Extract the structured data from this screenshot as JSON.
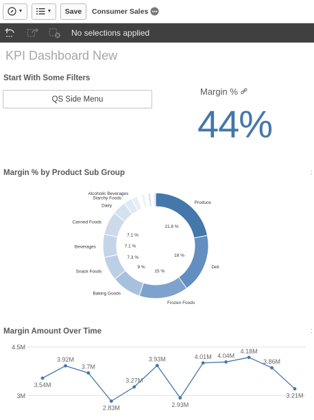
{
  "toolbar": {
    "compass_icon": "compass-icon",
    "list_icon": "list-icon",
    "save_label": "Save",
    "app_name": "Consumer Sales"
  },
  "selections": {
    "status": "No selections applied"
  },
  "sheet": {
    "title": "KPI Dashboard New"
  },
  "filters": {
    "title": "Start With Some Filters",
    "menu_button": "QS Side Menu"
  },
  "kpi": {
    "label": "Margin %",
    "value": "44%"
  },
  "colors": {
    "accent": "#4477aa",
    "selbar": "#404040"
  },
  "donut": {
    "title": "Margin % by Product Sub Group",
    "slices": [
      {
        "name": "Produce",
        "value": 21.8,
        "label": "21.8 %",
        "color": "#4477aa"
      },
      {
        "name": "Deli",
        "value": 18,
        "label": "18 %",
        "color": "#628ec0"
      },
      {
        "name": "Frozen Foods",
        "value": 15,
        "label": "15 %",
        "color": "#7ea2cd"
      },
      {
        "name": "Baking Goods",
        "value": 9,
        "label": "9 %",
        "color": "#a7c0dd"
      },
      {
        "name": "Snack Foods",
        "value": 7.3,
        "label": "7.3 %",
        "color": "#bccfe6"
      },
      {
        "name": "Beverages",
        "value": 7.1,
        "label": "7.1 %",
        "color": "#c4d5e9"
      },
      {
        "name": "Canned Foods",
        "value": 7.1,
        "label": "7.1 %",
        "color": "#ccdaec"
      },
      {
        "name": "Dairy",
        "value": 4.2,
        "label": "",
        "color": "#d6e1ef"
      },
      {
        "name": "Starchy Foods",
        "value": 2.6,
        "label": "",
        "color": "#e0e8f3"
      },
      {
        "name": "Alcoholic Beverages",
        "value": 1.8,
        "label": "",
        "color": "#e8eef6"
      },
      {
        "name": "",
        "value": 1.2,
        "label": "",
        "color": "#ffffff"
      },
      {
        "name": "",
        "value": 1.1,
        "label": "",
        "color": "#eef2f8"
      },
      {
        "name": "",
        "value": 1.0,
        "label": "",
        "color": "#ffffff"
      },
      {
        "name": "",
        "value": 0.9,
        "label": "",
        "color": "#dfe6f0"
      },
      {
        "name": "",
        "value": 0.8,
        "label": "",
        "color": "#ffffff"
      },
      {
        "name": "",
        "value": 0.7,
        "label": "",
        "color": "#e4eaf3"
      }
    ]
  },
  "chart_data": {
    "type": "line",
    "title": "Margin Amount Over Time",
    "values": [
      3.54,
      3.92,
      3.7,
      2.83,
      3.27,
      3.93,
      2.93,
      4.01,
      4.04,
      4.18,
      3.86,
      3.21
    ],
    "data_labels": [
      "3.54M",
      "3.92M",
      "3.7M",
      "2.83M",
      "3.27M",
      "3.93M",
      "2.93M",
      "4.01M",
      "4.04M",
      "4.18M",
      "3.86M",
      "3.21M"
    ],
    "yticks": [
      4.5,
      3
    ],
    "ytick_labels": [
      "4.5M",
      "3M"
    ],
    "ylim": [
      2.65,
      4.6
    ],
    "color": "#4477aa",
    "grid": true
  }
}
